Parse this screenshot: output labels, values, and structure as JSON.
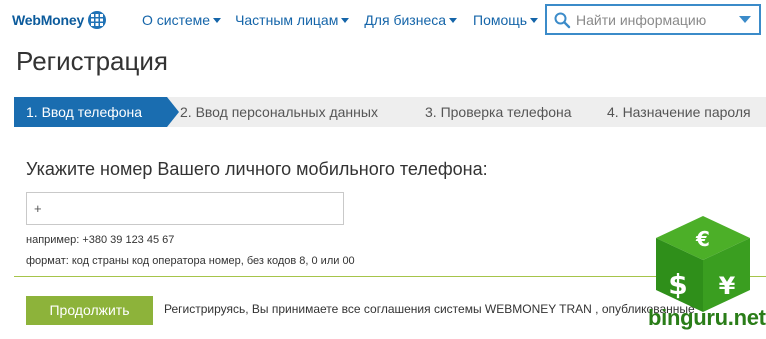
{
  "header": {
    "logo_text": "WebMoney",
    "nav": [
      {
        "label": "О системе"
      },
      {
        "label": "Частным лицам"
      },
      {
        "label": "Для бизнеса"
      },
      {
        "label": "Помощь"
      }
    ],
    "search": {
      "placeholder": "Найти информацию",
      "icon": "search-icon"
    }
  },
  "page": {
    "title": "Регистрация"
  },
  "steps": [
    {
      "label": "1. Ввод телефона",
      "active": true
    },
    {
      "label": "2. Ввод персональных данных",
      "active": false
    },
    {
      "label": "3. Проверка телефона",
      "active": false
    },
    {
      "label": "4. Назначение пароля",
      "active": false
    }
  ],
  "form": {
    "prompt": "Укажите номер Вашего личного мобильного телефона:",
    "phone_value": "+",
    "hint_example": "например: +380 39 123 45 67",
    "hint_format": "формат: код страны код оператора номер, без кодов 8, 0 или 00",
    "continue_label": "Продолжить",
    "agreement_text": "Регистрируясь, Вы принимаете все соглашения системы WEBMONEY TRAN    , опубликованные"
  },
  "watermark": {
    "text": "binguru.net",
    "symbols": [
      "€",
      "$",
      "¥"
    ]
  },
  "colors": {
    "brand_blue": "#1a6db0",
    "link_blue": "#1565a9",
    "button_green": "#8db33a",
    "divider_green": "#a6c44a",
    "watermark_green": "#2a7d18"
  }
}
